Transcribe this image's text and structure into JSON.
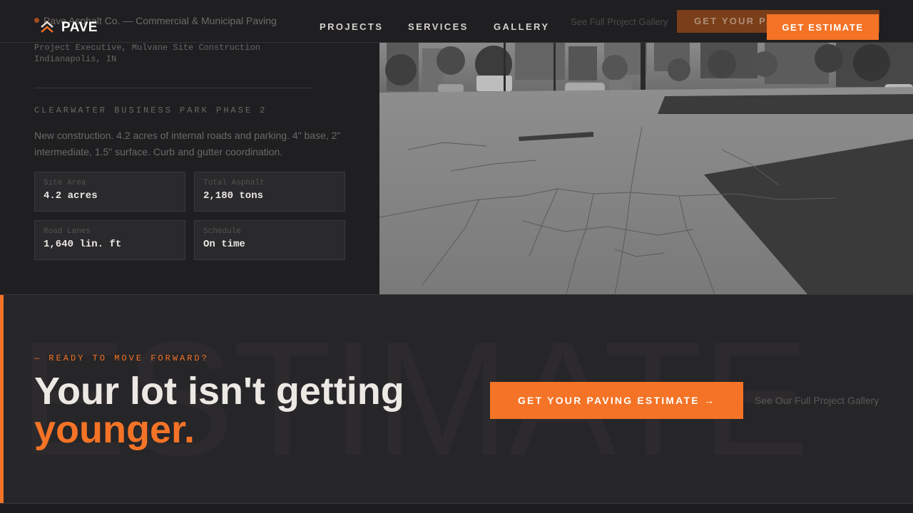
{
  "brand": {
    "name": "PAVE",
    "company_line": "Pave Asphalt Co. — Commercial & Municipal Paving"
  },
  "nav": {
    "links": [
      "PROJECTS",
      "SERVICES",
      "GALLERY"
    ],
    "ghost_gallery": "See Full Project Gallery",
    "ghost_cta": "GET YOUR PAVING ESTIMATE",
    "estimate_button": "GET ESTIMATE"
  },
  "project": {
    "role_line1": "Project Executive, Mulvane Site Construction",
    "role_line2": "Indianapolis, IN",
    "title": "CLEARWATER BUSINESS PARK PHASE 2",
    "description": "New construction. 4.2 acres of internal roads and parking. 4\" base, 2\" intermediate, 1.5\" surface. Curb and gutter coordination.",
    "stats": [
      {
        "label": "Site Area",
        "value": "4.2 acres"
      },
      {
        "label": "Total Asphalt",
        "value": "2,180 tons"
      },
      {
        "label": "Road Lanes",
        "value": "1,640 lin. ft"
      },
      {
        "label": "Schedule",
        "value": "On time"
      }
    ]
  },
  "cta": {
    "watermark": "ESTIMATE",
    "eyebrow": "— READY TO MOVE FORWARD?",
    "headline_line1": "Your lot isn't getting",
    "headline_accent": "younger.",
    "button": "GET YOUR PAVING ESTIMATE →",
    "gallery_link": "See Our Full Project Gallery"
  },
  "colors": {
    "accent": "#f47326",
    "background": "#1f1e21",
    "panel": "#2a292c"
  }
}
